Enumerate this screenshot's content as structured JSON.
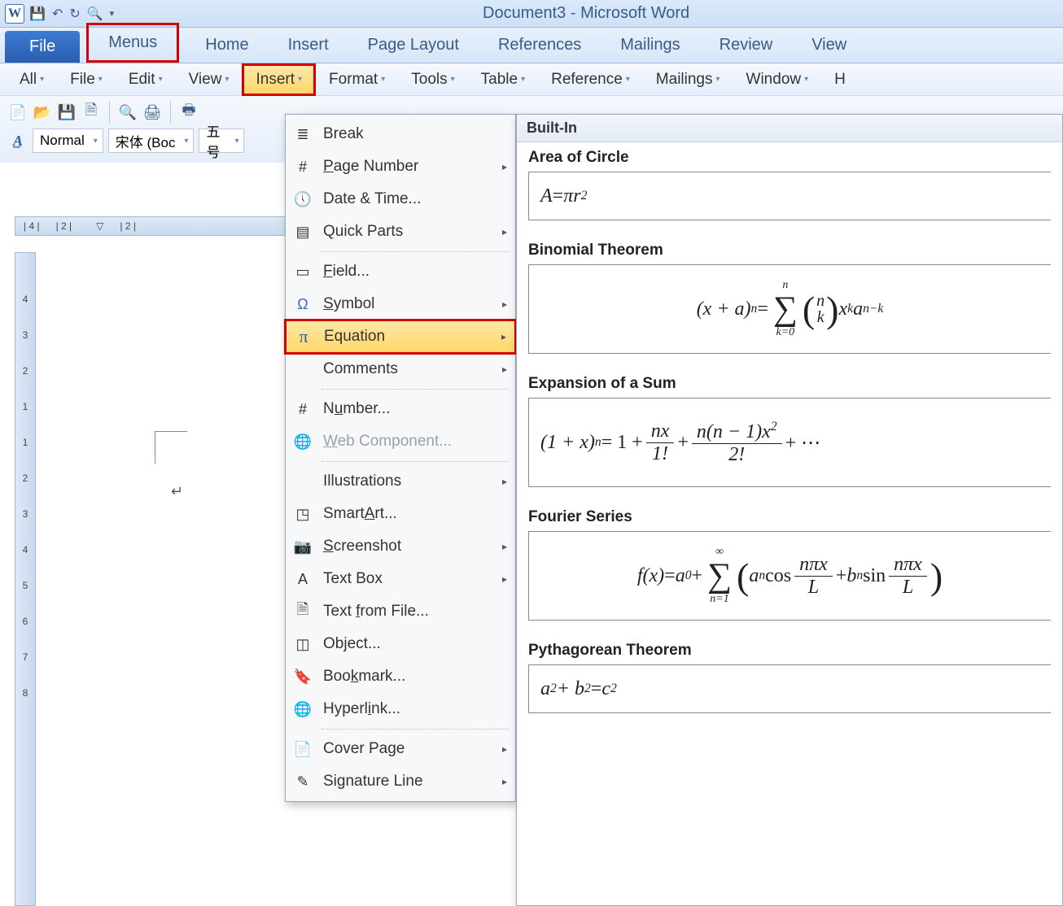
{
  "title": "Document3  -  Microsoft Word",
  "ribbon_tabs": {
    "file": "File",
    "menus": "Menus",
    "home": "Home",
    "insert": "Insert",
    "page_layout": "Page Layout",
    "references": "References",
    "mailings": "Mailings",
    "review": "Review",
    "view": "View"
  },
  "menu_bar": {
    "all": "All",
    "file": "File",
    "edit": "Edit",
    "view": "View",
    "insert": "Insert",
    "format": "Format",
    "tools": "Tools",
    "table": "Table",
    "reference": "Reference",
    "mailings": "Mailings",
    "window": "Window",
    "help_initial": "H"
  },
  "toolbar": {
    "style_label": "Normal",
    "font_label": "宋体 (Boc",
    "size_label": "五号"
  },
  "ruler_marks_h": [
    "| 4 |",
    "| 2 |",
    "| 2 |"
  ],
  "ruler_marks_v": [
    "4",
    "3",
    "2",
    "1",
    "1",
    "2",
    "3",
    "4",
    "5",
    "6",
    "7",
    "8"
  ],
  "insert_menu": {
    "break": "Break",
    "page_number": "Page Number",
    "date_time": "Date & Time...",
    "quick_parts": "Quick Parts",
    "field": "Field...",
    "symbol": "Symbol",
    "equation": "Equation",
    "comments": "Comments",
    "number": "Number...",
    "web_component": "Web Component...",
    "illustrations": "Illustrations",
    "smartart": "SmartArt...",
    "screenshot": "Screenshot",
    "text_box": "Text Box",
    "text_from_file": "Text from File...",
    "object": "Object...",
    "bookmark": "Bookmark...",
    "hyperlink": "Hyperlink...",
    "cover_page": "Cover Page",
    "signature_line": "Signature Line"
  },
  "gallery": {
    "header": "Built-In",
    "items": {
      "area_circle": {
        "title": "Area of Circle",
        "formula_plain": "A = π r^2"
      },
      "binomial": {
        "title": "Binomial Theorem",
        "formula_plain": "(x + a)^n = Σ_{k=0}^{n} C(n,k) x^k a^{n-k}"
      },
      "expansion": {
        "title": "Expansion of a Sum",
        "formula_plain": "(1 + x)^n = 1 + nx/1! + n(n-1)x^2/2! + ..."
      },
      "fourier": {
        "title": "Fourier Series",
        "formula_plain": "f(x) = a_0 + Σ_{n=1}^{∞} ( a_n cos(nπx/L) + b_n sin(nπx/L) )"
      },
      "pythag": {
        "title": "Pythagorean Theorem",
        "formula_plain": "a^2 + b^2 = c^2"
      }
    }
  }
}
